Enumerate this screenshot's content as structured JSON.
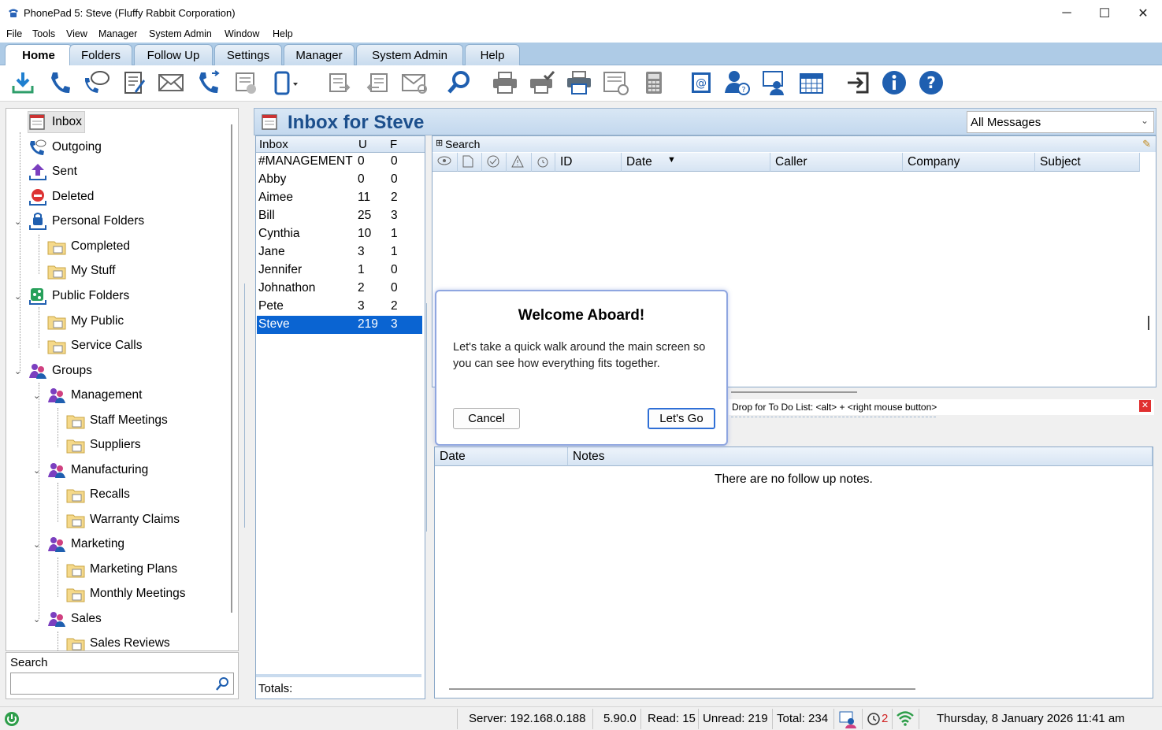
{
  "window": {
    "title": "PhonePad 5: Steve  (Fluffy Rabbit Corporation)",
    "minimize": "─",
    "maximize": "☐",
    "close": "✕"
  },
  "menu": [
    "File",
    "Tools",
    "View",
    "Manager",
    "System Admin",
    "Window",
    "Help"
  ],
  "tabs": [
    "Home",
    "Folders",
    "Follow Up",
    "Settings",
    "Manager",
    "System Admin",
    "Help"
  ],
  "toolbar_icons": [
    "download-icon",
    "phone-icon",
    "phone-message-icon",
    "edit-message-icon",
    "envelope-icon",
    "call-transfer-icon",
    "message-delete-icon",
    "mobile-icon",
    "forward-icon",
    "reply-icon",
    "mail-refresh-icon",
    "search-icon",
    "print-icon",
    "print-check-icon",
    "print-preview-icon",
    "web-message-icon",
    "calculator-icon",
    "email-address-icon",
    "user-help-icon",
    "support-icon",
    "calendar-icon",
    "logout-icon",
    "info-icon",
    "help-icon"
  ],
  "tree": {
    "inbox": "Inbox",
    "outgoing": "Outgoing",
    "sent": "Sent",
    "deleted": "Deleted",
    "personal_folders": "Personal Folders",
    "completed": "Completed",
    "my_stuff": "My Stuff",
    "public_folders": "Public Folders",
    "my_public": "My Public",
    "service_calls": "Service Calls",
    "groups": "Groups",
    "management": "Management",
    "staff_meetings": "Staff Meetings",
    "suppliers": "Suppliers",
    "manufacturing": "Manufacturing",
    "recalls": "Recalls",
    "warranty_claims": "Warranty Claims",
    "marketing": "Marketing",
    "marketing_plans": "Marketing Plans",
    "monthly_meetings": "Monthly Meetings",
    "sales": "Sales",
    "sales_reviews": "Sales Reviews"
  },
  "left_search": {
    "label": "Search"
  },
  "inbox_header": {
    "title": "Inbox for Steve",
    "filter": "All Messages"
  },
  "inbox_list": {
    "headers": {
      "name": "Inbox",
      "u": "U",
      "f": "F"
    },
    "rows": [
      {
        "name": "#MANAGEMENT",
        "u": "0",
        "f": "0"
      },
      {
        "name": "Abby",
        "u": "0",
        "f": "0"
      },
      {
        "name": "Aimee",
        "u": "11",
        "f": "2"
      },
      {
        "name": "Bill",
        "u": "25",
        "f": "3"
      },
      {
        "name": "Cynthia",
        "u": "10",
        "f": "1"
      },
      {
        "name": "Jane",
        "u": "3",
        "f": "1"
      },
      {
        "name": "Jennifer",
        "u": "1",
        "f": "0"
      },
      {
        "name": "Johnathon",
        "u": "2",
        "f": "0"
      },
      {
        "name": "Pete",
        "u": "3",
        "f": "2"
      },
      {
        "name": "Steve",
        "u": "219",
        "f": "3"
      }
    ],
    "totals": "Totals:"
  },
  "message_grid": {
    "search": "Search",
    "columns": [
      "ID",
      "Date",
      "Caller",
      "Company",
      "Subject"
    ]
  },
  "dropbar": {
    "text": "Drop for To Do List: <alt> + <right mouse button>"
  },
  "notes": {
    "columns": [
      "Date",
      "Notes"
    ],
    "empty": "There are no follow up notes."
  },
  "dialog": {
    "title": "Welcome Aboard!",
    "body": "Let's take a quick walk around the main screen so you can see how everything fits together.",
    "cancel": "Cancel",
    "go": "Let's Go"
  },
  "status": {
    "server": "Server: 192.168.0.188",
    "version": "5.90.0",
    "read": "Read: 15",
    "unread": "Unread: 219",
    "total": "Total: 234",
    "alarms": "2",
    "datetime": "Thursday, 8 January 2026  11:41 am"
  },
  "colors": {
    "accent": "#0a64d2",
    "header_text": "#1c4f8c",
    "ribbon": "#aecbe6"
  }
}
